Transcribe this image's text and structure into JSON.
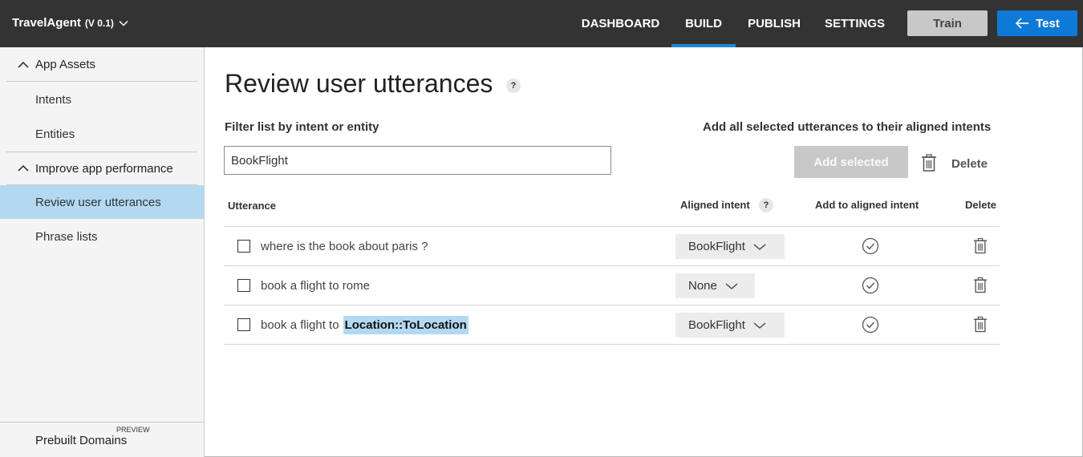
{
  "header": {
    "app_name": "TravelAgent",
    "version": "(V 0.1)",
    "nav": [
      {
        "label": "DASHBOARD",
        "active": false
      },
      {
        "label": "BUILD",
        "active": true
      },
      {
        "label": "PUBLISH",
        "active": false
      },
      {
        "label": "SETTINGS",
        "active": false
      }
    ],
    "train_label": "Train",
    "test_label": "Test"
  },
  "sidebar": {
    "sections": [
      {
        "label": "App Assets",
        "items": [
          "Intents",
          "Entities"
        ]
      },
      {
        "label": "Improve app performance",
        "items": [
          "Review user utterances",
          "Phrase lists"
        ]
      }
    ],
    "active_item": "Review user utterances",
    "prebuilt_label": "Prebuilt Domains",
    "preview_tag": "PREVIEW"
  },
  "main": {
    "title": "Review user utterances",
    "help": "?",
    "filter_label": "Filter list by intent or entity",
    "filter_value": "BookFlight",
    "add_all_label": "Add all selected utterances to their aligned intents",
    "add_selected_label": "Add selected",
    "delete_label": "Delete",
    "table": {
      "headers": {
        "utterance": "Utterance",
        "aligned_intent": "Aligned intent",
        "add_to_aligned": "Add to aligned intent",
        "delete": "Delete"
      },
      "rows": [
        {
          "text": "where is the book about paris ?",
          "entity": "",
          "intent": "BookFlight"
        },
        {
          "text": "book a flight to rome",
          "entity": "",
          "intent": "None"
        },
        {
          "text": "book a flight to",
          "entity": "Location::ToLocation",
          "intent": "BookFlight"
        }
      ]
    }
  },
  "colors": {
    "topbar": "#333333",
    "accent": "#0e7ad8",
    "selection": "#b3d9f2"
  }
}
